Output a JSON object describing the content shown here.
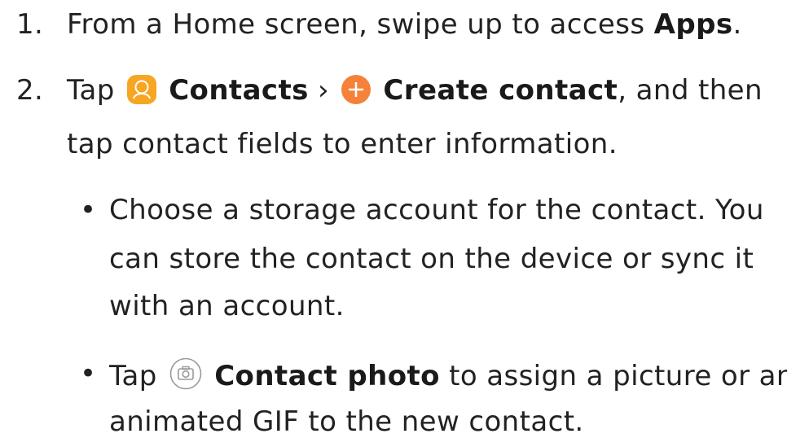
{
  "steps": [
    {
      "number": "1.",
      "text_before": "From a Home screen, swipe up to access ",
      "bold": "Apps",
      "text_after": "."
    },
    {
      "number": "2.",
      "tap": "Tap",
      "contacts_label": "Contacts",
      "separator": "›",
      "create_label": "Create contact",
      "text_after": ", and then",
      "line2": "tap contact fields to enter information."
    }
  ],
  "bullets": [
    {
      "symbol": "•",
      "lines": [
        "Choose a storage account for the contact. You",
        "can store the contact on the device or sync it",
        "with an account."
      ]
    },
    {
      "symbol": "•",
      "tap": "Tap",
      "bold": "Contact photo",
      "text_after": " to assign a picture or an",
      "line2": "animated GIF to the new contact."
    }
  ],
  "icons": {
    "contacts": "contacts-app-icon",
    "create": "plus-circle-icon",
    "camera": "camera-icon"
  },
  "colors": {
    "contacts_icon": "#F6A623",
    "create_icon": "#F5813A",
    "text": "#222222",
    "camera_outline": "#9A9A9A"
  }
}
